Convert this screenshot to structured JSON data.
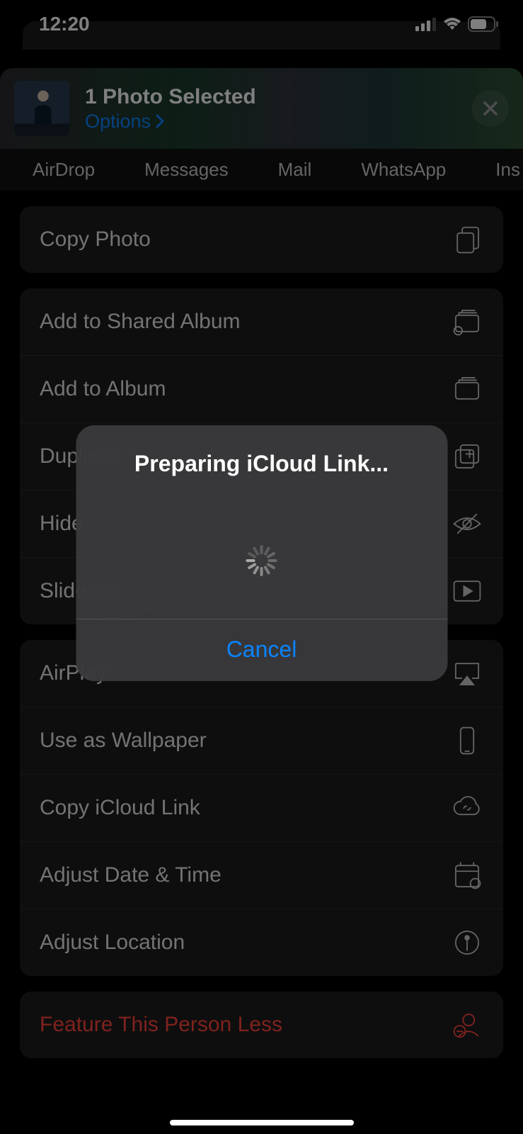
{
  "status": {
    "time": "12:20"
  },
  "header": {
    "title": "1 Photo Selected",
    "options": "Options"
  },
  "share_apps": [
    "AirDrop",
    "Messages",
    "Mail",
    "WhatsApp",
    "Ins"
  ],
  "actions": {
    "copy_photo": "Copy Photo",
    "add_shared_album": "Add to Shared Album",
    "add_album": "Add to Album",
    "duplicate": "Duplicate",
    "hide": "Hide",
    "slideshow": "Slideshow",
    "airplay": "AirPlay",
    "use_wallpaper": "Use as Wallpaper",
    "copy_icloud": "Copy iCloud Link",
    "adjust_date": "Adjust Date & Time",
    "adjust_location": "Adjust Location",
    "feature_less": "Feature This Person Less"
  },
  "modal": {
    "title": "Preparing iCloud Link...",
    "cancel": "Cancel"
  }
}
